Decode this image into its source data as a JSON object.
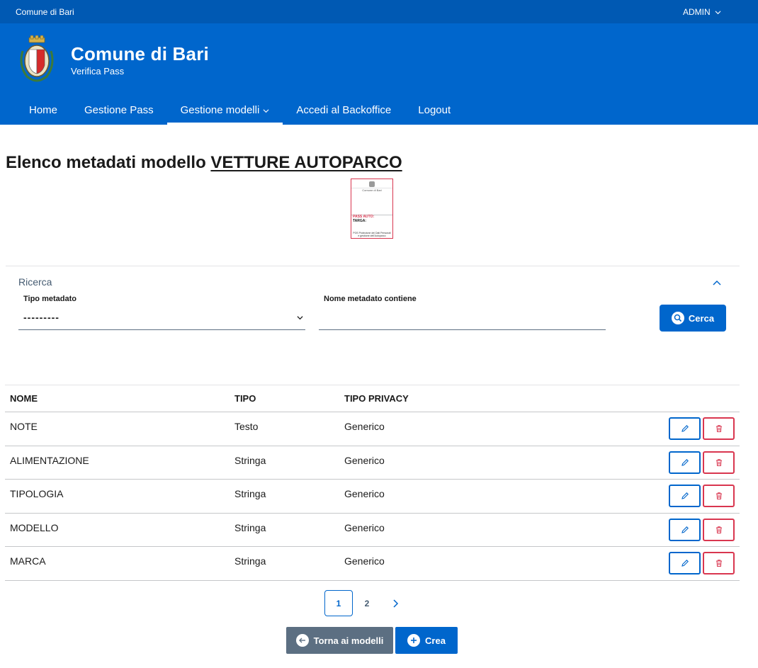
{
  "slim_header": {
    "org_name": "Comune di Bari",
    "user_label": "ADMIN",
    "user_icon": "chevron-down-icon"
  },
  "header": {
    "title": "Comune di Bari",
    "subtitle": "Verifica Pass",
    "logo_icon": "coat-of-arms-icon",
    "nav": [
      {
        "label": "Home",
        "active": false
      },
      {
        "label": "Gestione Pass",
        "active": false
      },
      {
        "label": "Gestione modelli",
        "active": true,
        "dropdown": true
      },
      {
        "label": "Accedi al Backoffice",
        "active": false
      },
      {
        "label": "Logout",
        "active": false
      }
    ]
  },
  "page": {
    "title_prefix": "Elenco metadati modello",
    "model_name": "VETTURE AUTOPARCO",
    "thumbnail": {
      "header": "Comune di Bari",
      "pass": "PASS AUTO:",
      "targa": "TARGA:",
      "footer": "POS Protezione dei Dati Personali e gestione dell'Autoparco"
    }
  },
  "search": {
    "title": "Ricerca",
    "tipo_label": "Tipo metadato",
    "tipo_value": "---------",
    "nome_label": "Nome metadato contiene",
    "nome_value": "",
    "button_label": "Cerca"
  },
  "table": {
    "headers": {
      "nome": "NOME",
      "tipo": "TIPO",
      "privacy": "TIPO PRIVACY"
    },
    "rows": [
      {
        "nome": "NOTE",
        "tipo": "Testo",
        "privacy": "Generico"
      },
      {
        "nome": "ALIMENTAZIONE",
        "tipo": "Stringa",
        "privacy": "Generico"
      },
      {
        "nome": "TIPOLOGIA",
        "tipo": "Stringa",
        "privacy": "Generico"
      },
      {
        "nome": "MODELLO",
        "tipo": "Stringa",
        "privacy": "Generico"
      },
      {
        "nome": "MARCA",
        "tipo": "Stringa",
        "privacy": "Generico"
      }
    ]
  },
  "pagination": {
    "pages": [
      "1",
      "2"
    ],
    "current": "1"
  },
  "actions": {
    "back_label": "Torna ai modelli",
    "create_label": "Crea"
  },
  "colors": {
    "primary": "#0066cc",
    "primary_dark": "#0059b3",
    "danger": "#d9364f",
    "secondary": "#5c6f82"
  }
}
